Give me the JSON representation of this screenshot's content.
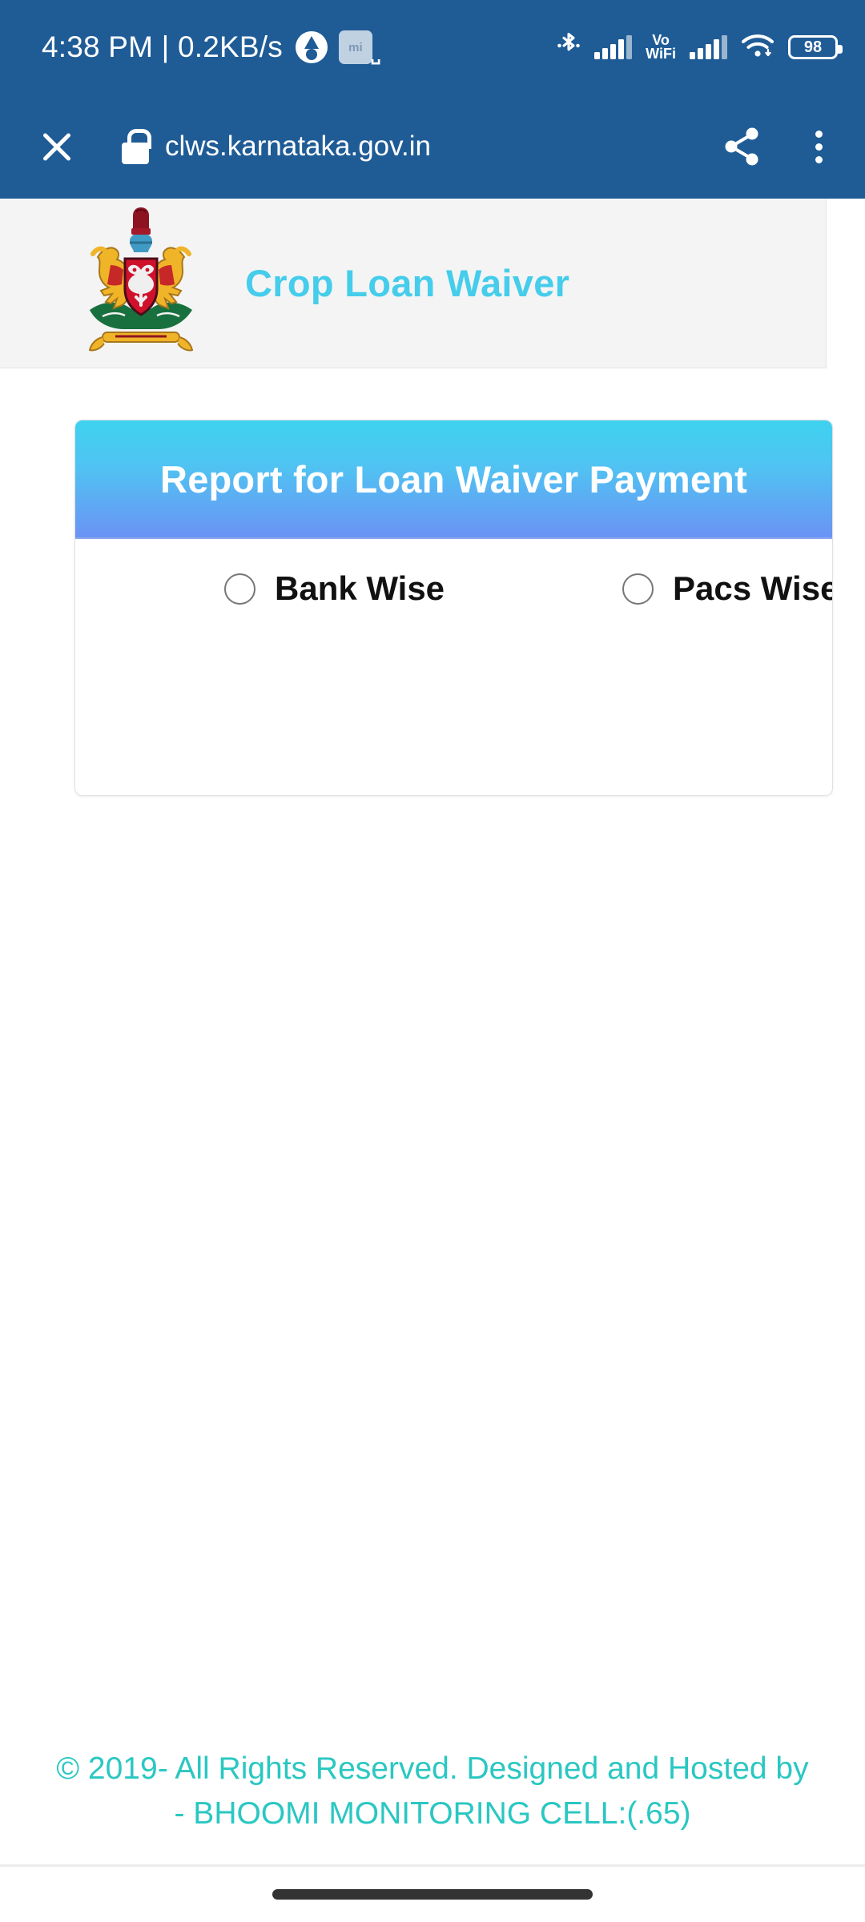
{
  "status_bar": {
    "clock": "4:38 PM | 0.2KB/s",
    "app_icons": [
      {
        "name": "adguard-icon",
        "label": "A"
      },
      {
        "name": "mi-app-icon",
        "label": "mi"
      },
      {
        "name": "m-app-icon",
        "label": "m"
      }
    ],
    "bluetooth_icon": "bluetooth-icon",
    "signal_1": "signal-bars-icon",
    "vowifi_line1": "Vo",
    "vowifi_line2": "WiFi",
    "signal_2": "signal-bars-icon",
    "wifi_icon": "wifi-icon",
    "battery_level": "98"
  },
  "browser": {
    "close_label": "close-tab",
    "lock_label": "secure-connection",
    "url": "clws.karnataka.gov.in",
    "share_label": "share",
    "menu_label": "more-options"
  },
  "site_header": {
    "emblem_alt": "Karnataka Government Emblem",
    "title": "Crop Loan Waiver"
  },
  "report_card": {
    "heading": "Report for Loan Waiver Payment",
    "options": [
      {
        "id": "bank-wise",
        "label": "Bank Wise",
        "selected": false
      },
      {
        "id": "pacs-wise",
        "label": "Pacs Wise",
        "selected": false
      }
    ]
  },
  "footer": {
    "line1": "© 2019- All Rights Reserved. Designed and Hosted by",
    "line2": "- BHOOMI MONITORING CELL:(.65)"
  },
  "colors": {
    "browser_chrome": "#1f5c96",
    "site_title": "#45cdeb",
    "card_gradient_top": "#3ed2ef",
    "card_gradient_bottom": "#6b93f5",
    "footer_text": "#2ac7c2",
    "header_strip": "#f4f4f4"
  }
}
